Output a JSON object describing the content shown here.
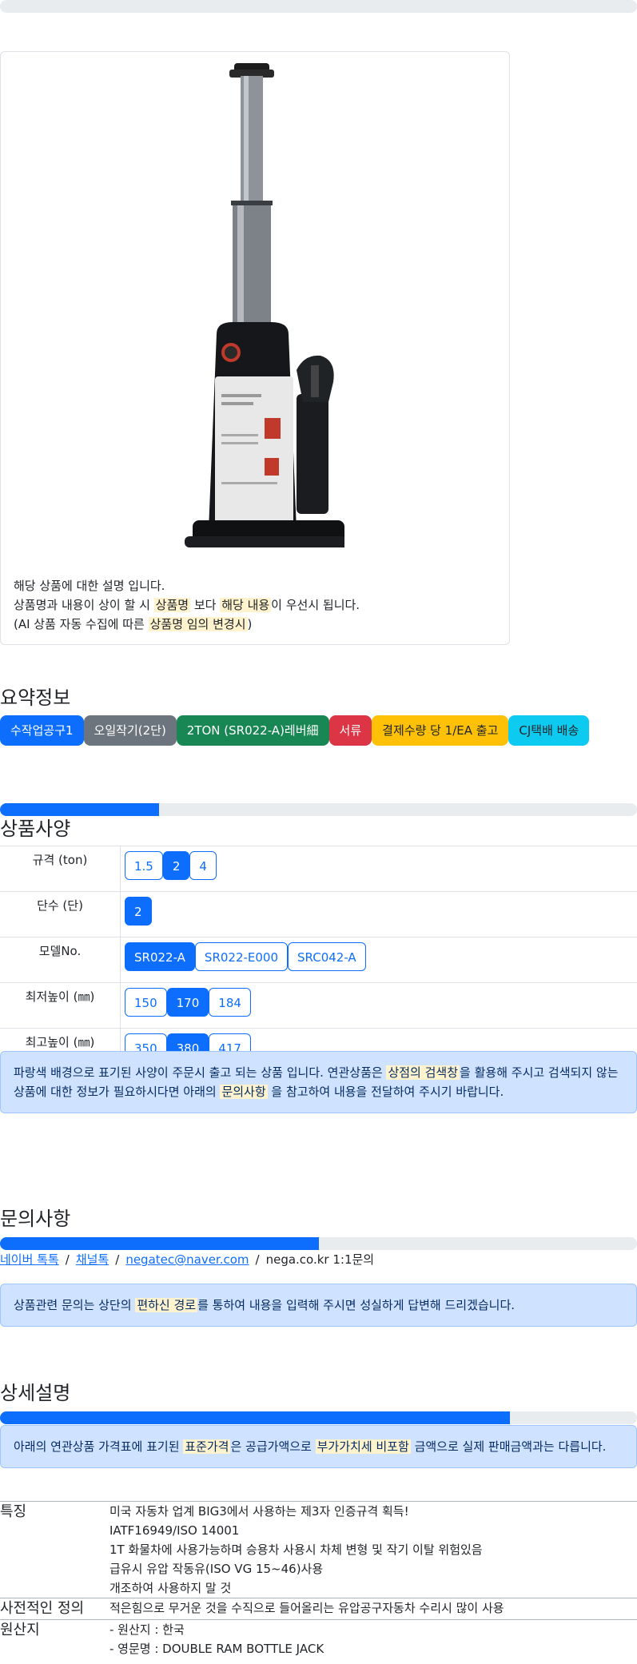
{
  "card": {
    "desc_line1": "해당 상품에 대한 설명 입니다.",
    "desc_line2_a": "상품명과 내용이 상이 할 시 ",
    "desc_line2_hl1": "상품명",
    "desc_line2_b": " 보다 ",
    "desc_line2_hl2": "해당 내용",
    "desc_line2_c": "이 우선시 됩니다.",
    "desc_line3_a": "(AI 상품 자동 수집에 따른 ",
    "desc_line3_hl": "상품명 임의 변경시",
    "desc_line3_b": ")"
  },
  "summary": {
    "title": "요약정보",
    "badges": [
      "수작업공구1",
      "오일작기(2단)",
      "2TON (SR022-A)레버細",
      "서류",
      "결제수량 당 1/EA 출고",
      "CJ택배 배송"
    ]
  },
  "spec": {
    "title": "상품사양",
    "progress": 0.25,
    "rows": [
      {
        "label": "규격 (ton)",
        "options": [
          "1.5",
          "2",
          "4"
        ],
        "selected": 1
      },
      {
        "label": "단수 (단)",
        "options": [
          "2"
        ],
        "selected": 0
      },
      {
        "label": "모델No.",
        "options": [
          "SR022-A",
          "SR022-E000",
          "SRC042-A"
        ],
        "selected": 0
      },
      {
        "label": "최저높이 (㎜)",
        "options": [
          "150",
          "170",
          "184"
        ],
        "selected": 1
      },
      {
        "label": "최고높이 (㎜)",
        "options": [
          "350",
          "380",
          "417"
        ],
        "selected": 1
      }
    ],
    "notice_a": "파랑색 배경으로 표기된 사양이 주문시 출고 되는 상품 입니다. 연관상품은 ",
    "notice_hl1": "상점의 검색창",
    "notice_b": "을 활용해 주시고 검색되지 않는 상품에 대한 정보가 필요하시다면 아래의 ",
    "notice_hl2": "문의사항",
    "notice_c": " 을 참고하여 내용을 전달하여 주시기 바랍니다."
  },
  "inquiry": {
    "title": "문의사항",
    "progress": 0.5,
    "link1": "네이버 톡톡",
    "link2": "채널톡",
    "link3": "negatec@naver.com",
    "sep": "/",
    "plain": "nega.co.kr 1:1문의",
    "notice_a": "상품관련 문의는 상단의 ",
    "notice_hl": "편하신 경로",
    "notice_b": "를 통하여 내용을 입력해 주시면 성실하게 답변해 드리겠습니다."
  },
  "detail": {
    "title": "상세설명",
    "progress": 0.8,
    "notice_a": "아래의 연관상품 가격표에 표기된 ",
    "notice_hl1": "표준가격",
    "notice_b": "은 공급가액으로 ",
    "notice_hl2": "부가가치세 비포함",
    "notice_c": " 금액으로 실제 판매금액과는 다릅니다.",
    "rows": [
      {
        "key": "특징",
        "lines": [
          "미국 자동차 업계 BIG3에서 사용하는 제3자 인증규격 획득!",
          "IATF16949/ISO 14001",
          "1T 화물차에 사용가능하며 승용차 사용시 차체 변형 및 작기 이탈 위험있음",
          "급유시 유압 작동유(ISO VG 15~46)사용",
          "개조하여 사용하지 말 것"
        ]
      },
      {
        "key": "사전적인 정의",
        "lines": [
          "적은힘으로 무거운 것을 수직으로 들어올리는 유압공구자동차 수리시 많이 사용"
        ]
      },
      {
        "key": "원산지",
        "lines": [
          "- 원산지 : 한국",
          "- 영문명 : DOUBLE RAM BOTTLE JACK"
        ]
      }
    ]
  },
  "colors": {
    "primary": "#0d6efd",
    "highlight": "#fff3cd",
    "alert_bg": "#cfe2ff"
  }
}
